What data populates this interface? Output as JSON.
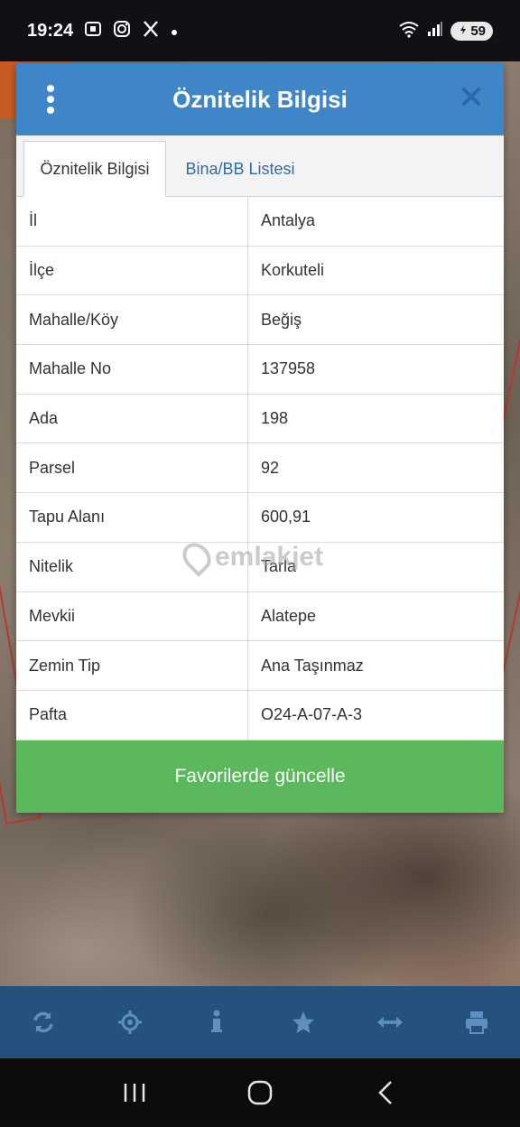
{
  "status_bar": {
    "time": "19:24",
    "battery": "59"
  },
  "dialog": {
    "title": "Öznitelik Bilgisi",
    "tabs": [
      {
        "label": "Öznitelik Bilgisi",
        "active": true
      },
      {
        "label": "Bina/BB Listesi",
        "active": false
      }
    ],
    "rows": [
      {
        "key": "İl",
        "value": "Antalya"
      },
      {
        "key": "İlçe",
        "value": "Korkuteli"
      },
      {
        "key": "Mahalle/Köy",
        "value": "Beğiş"
      },
      {
        "key": "Mahalle No",
        "value": "137958"
      },
      {
        "key": "Ada",
        "value": "198"
      },
      {
        "key": "Parsel",
        "value": "92"
      },
      {
        "key": "Tapu Alanı",
        "value": "600,91"
      },
      {
        "key": "Nitelik",
        "value": "Tarla"
      },
      {
        "key": "Mevkii",
        "value": "Alatepe"
      },
      {
        "key": "Zemin Tip",
        "value": "Ana Taşınmaz"
      },
      {
        "key": "Pafta",
        "value": "O24-A-07-A-3"
      }
    ],
    "button_label": "Favorilerde güncelle"
  },
  "watermark": "emlakjet",
  "toolbar": {
    "icons": [
      "refresh-icon",
      "locate-icon",
      "info-icon",
      "star-icon",
      "measure-icon",
      "print-icon"
    ]
  },
  "navbar": {
    "icons": [
      "recent-apps-icon",
      "home-icon",
      "back-icon"
    ]
  },
  "colors": {
    "header": "#3f86c8",
    "button": "#5cb85c",
    "toolbar": "#24527c",
    "tab_link": "#2e6da4"
  }
}
